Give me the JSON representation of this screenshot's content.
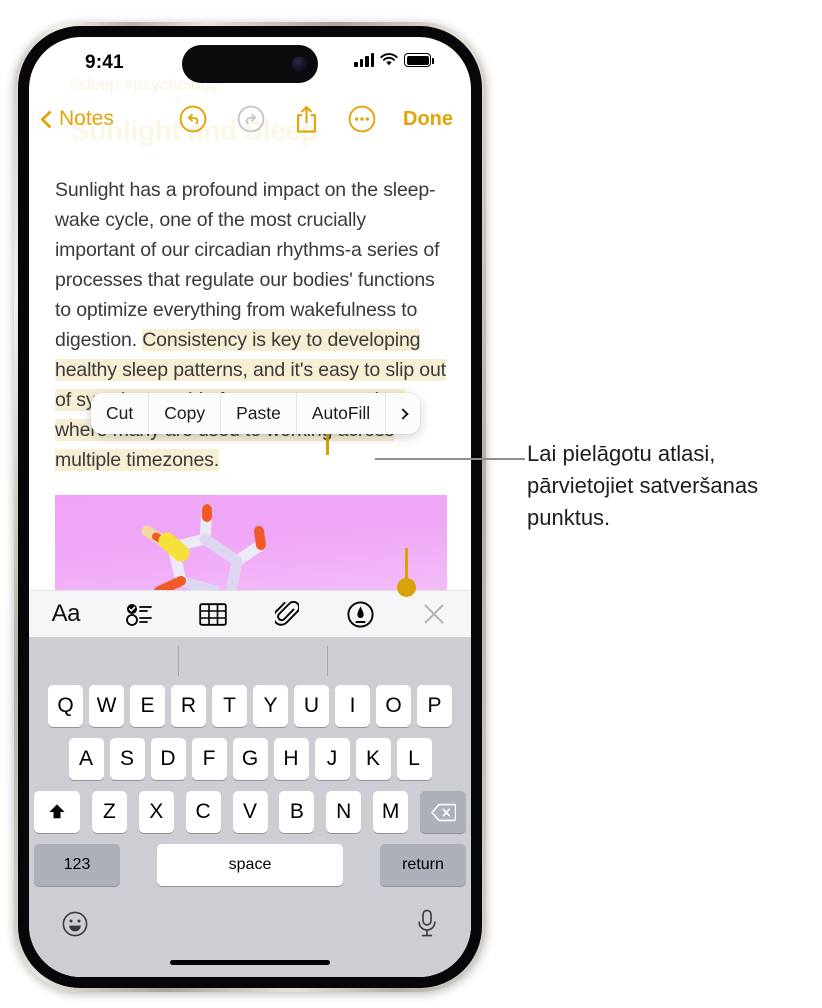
{
  "status_bar": {
    "time": "9:41",
    "signal_icon": "cellular-signal-icon",
    "wifi_icon": "wifi-icon",
    "battery_icon": "battery-icon"
  },
  "nav_bar": {
    "back_label": "Notes",
    "undo_icon": "undo-icon",
    "redo_icon": "redo-icon",
    "share_icon": "share-icon",
    "more_icon": "more-ellipsis-icon",
    "done_label": "Done",
    "ghost_title": "Sunlight and Sleep",
    "ghost_tags": "#sleep #psychology"
  },
  "note": {
    "paragraph_before": "Sunlight has a profound impact on the sleep-wake cycle, one of the most crucially important of our circadian rhythms-a series of processes that regulate our bodies' functions to optimize everything from wakefulness to digestion. ",
    "selected_text": "Consistency is key to developing healthy sleep patterns, and it's easy to slip out of sync in a world of constant connection, where many are used to working across multiple timezones.",
    "selection_highlight_color": "#F7EFD4",
    "handle_color": "#D9A209",
    "attachment_name": "molecule-image-attachment"
  },
  "edit_menu": {
    "items": [
      {
        "label": "Cut",
        "name": "cut-menu-item"
      },
      {
        "label": "Copy",
        "name": "copy-menu-item"
      },
      {
        "label": "Paste",
        "name": "paste-menu-item"
      },
      {
        "label": "AutoFill",
        "name": "autofill-menu-item"
      }
    ],
    "more_icon": "chevron-right-icon"
  },
  "format_toolbar": {
    "items": [
      {
        "label": "Aa",
        "name": "text-format-button"
      },
      {
        "label": "",
        "name": "checklist-button"
      },
      {
        "label": "",
        "name": "table-button"
      },
      {
        "label": "",
        "name": "attachment-paperclip-button"
      },
      {
        "label": "",
        "name": "markup-pen-button"
      },
      {
        "label": "",
        "name": "close-toolbar-button"
      }
    ]
  },
  "keyboard": {
    "row1": [
      "Q",
      "W",
      "E",
      "R",
      "T",
      "Y",
      "U",
      "I",
      "O",
      "P"
    ],
    "row2": [
      "A",
      "S",
      "D",
      "F",
      "G",
      "H",
      "J",
      "K",
      "L"
    ],
    "row3": [
      "Z",
      "X",
      "C",
      "V",
      "B",
      "N",
      "M"
    ],
    "shift_icon": "shift-key-icon",
    "backspace_icon": "backspace-key-icon",
    "numbers_label": "123",
    "space_label": "space",
    "return_label": "return",
    "emoji_icon": "emoji-keyboard-icon",
    "dictation_icon": "microphone-dictation-icon"
  },
  "callout": {
    "text": "Lai pielāgotu atlasi, pārvietojiet satveršanas punktus.",
    "leader_color": "#8E8E93"
  },
  "colors": {
    "accent_amber": "#E3A309",
    "keyboard_bg": "#CCCED3",
    "key_gray": "#ACB0B9",
    "toolbar_bg": "#F6F5F8"
  }
}
